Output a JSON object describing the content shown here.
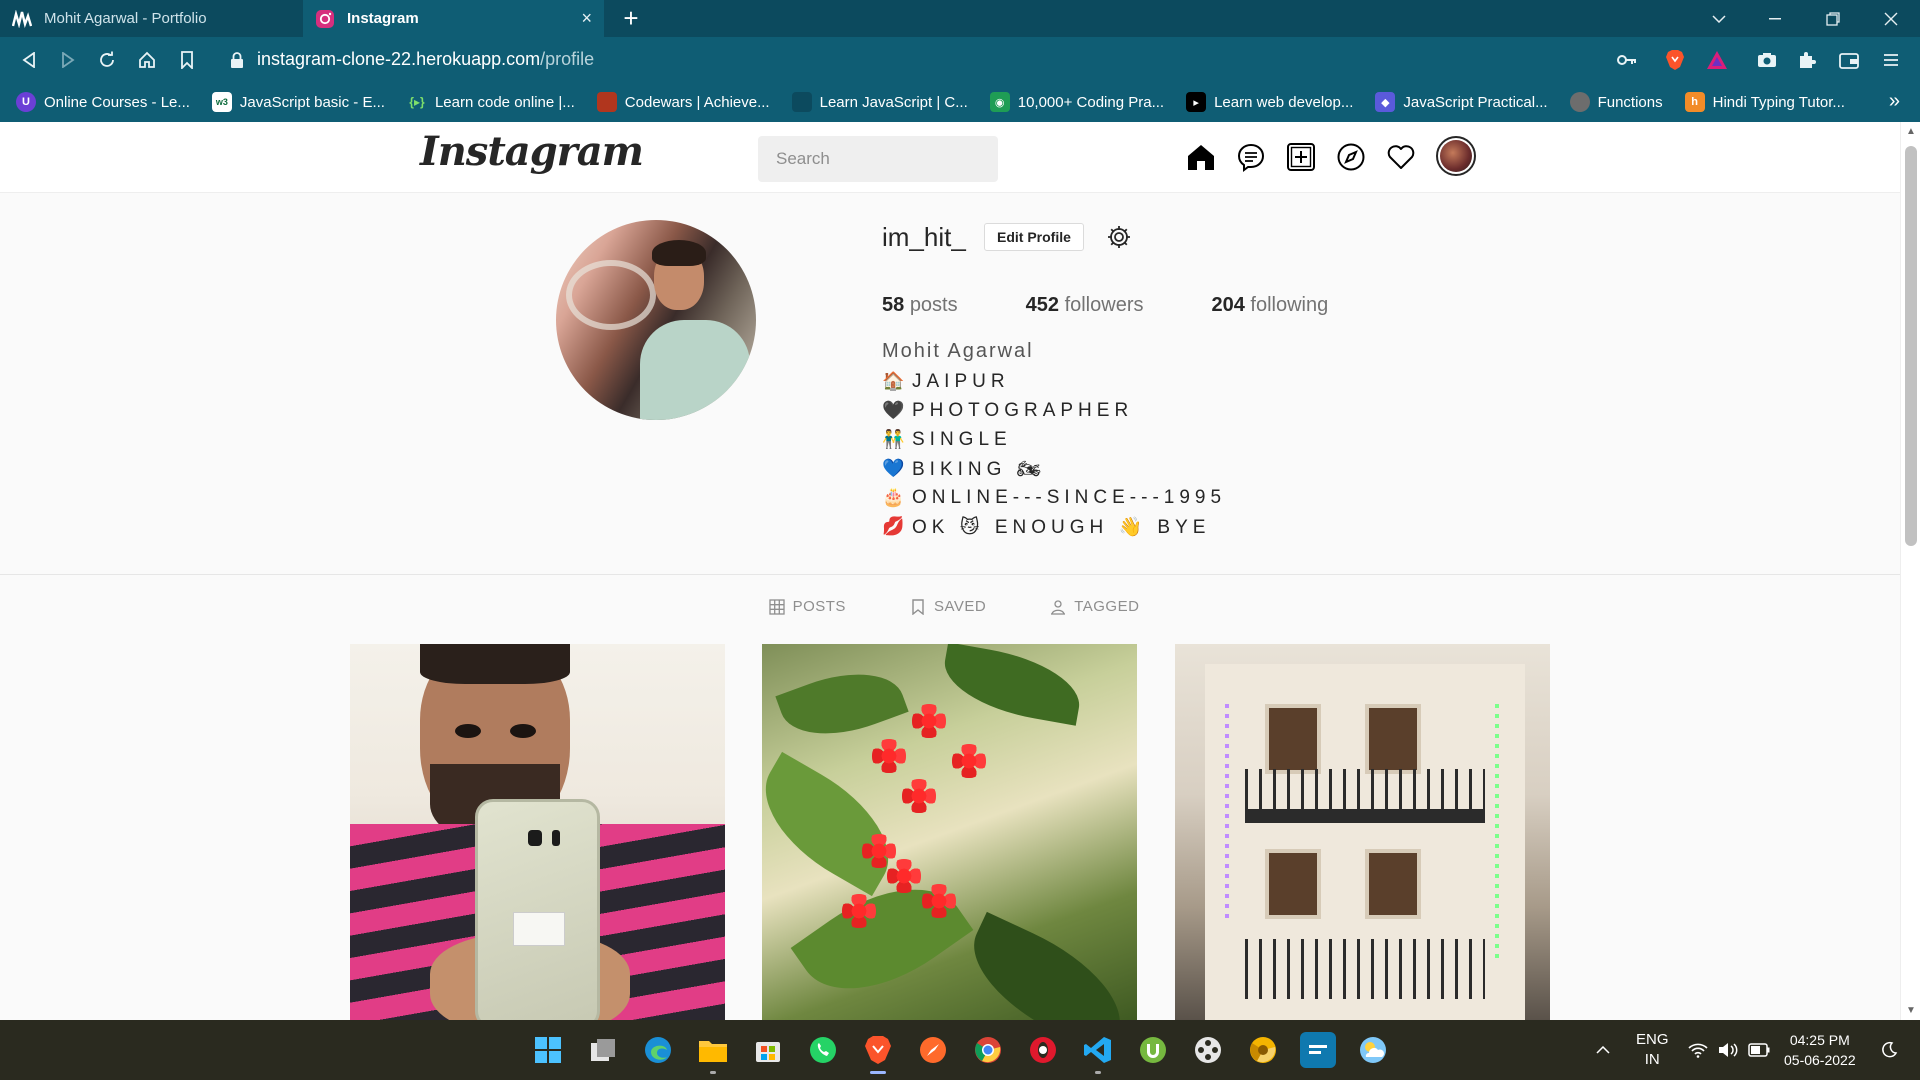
{
  "browser": {
    "tabs": [
      {
        "label": "Mohit Agarwal - Portfolio",
        "active": false,
        "icon": "portfolio-logo-icon"
      },
      {
        "label": "Instagram",
        "active": true,
        "icon": "instagram-icon",
        "close": "×"
      }
    ],
    "new_tab": "+",
    "url_host": "instagram-clone-22.herokuapp.com",
    "url_path": "/profile",
    "bookmarks": [
      {
        "label": "Online Courses - Le...",
        "icon_text": "U",
        "color": "#6b3fd6"
      },
      {
        "label": "JavaScript basic - E...",
        "icon_text": "w3",
        "color": "#ffffff"
      },
      {
        "label": "Learn code online |...",
        "icon_text": "{▸}",
        "color": "#0f5d74"
      },
      {
        "label": "Codewars | Achieve...",
        "icon_text": "",
        "color": "#b1361e"
      },
      {
        "label": "Learn JavaScript | C...",
        "icon_text": "",
        "color": "#0f5d74"
      },
      {
        "label": "10,000+ Coding Pra...",
        "icon_text": "◉",
        "color": "#1f9d55"
      },
      {
        "label": "Learn web develop...",
        "icon_text": "▸",
        "color": "#000000"
      },
      {
        "label": "JavaScript Practical...",
        "icon_text": "◆",
        "color": "#5a5adb"
      },
      {
        "label": "Functions",
        "icon_text": "",
        "color": "#6d6d6d"
      },
      {
        "label": "Hindi Typing Tutor...",
        "icon_text": "h",
        "color": "#f28c28"
      }
    ],
    "bookmarks_more": "»"
  },
  "instagram": {
    "logo": "Instagram",
    "search_placeholder": "Search",
    "profile": {
      "username": "im_hit_",
      "edit_label": "Edit Profile",
      "stats": [
        {
          "value": "58",
          "label": "posts"
        },
        {
          "value": "452",
          "label": "followers"
        },
        {
          "value": "204",
          "label": "following"
        }
      ],
      "full_name": "Mohit Agarwal",
      "bio": [
        {
          "emoji": "🏠",
          "text": "JAIPUR"
        },
        {
          "emoji": "🖤",
          "text": "PHOTOGRAPHER"
        },
        {
          "emoji": "👬",
          "text": "SINGLE"
        },
        {
          "emoji": "💙",
          "text": "BIKING 🏍"
        },
        {
          "emoji": "🎂",
          "text": "ONLINE---SINCE---1995"
        },
        {
          "emoji": "💋",
          "text": "OK 😼 ENOUGH 👋 BYE"
        }
      ]
    },
    "tabs": [
      {
        "label": "POSTS",
        "icon": "grid-icon"
      },
      {
        "label": "SAVED",
        "icon": "bookmark-icon"
      },
      {
        "label": "TAGGED",
        "icon": "tag-person-icon"
      }
    ]
  },
  "taskbar": {
    "language_line1": "ENG",
    "language_line2": "IN",
    "time": "04:25 PM",
    "date": "05-06-2022",
    "show_hidden": "^"
  },
  "colors": {
    "browser_tab_bar": "#0c4a5e",
    "browser_toolbar": "#0f5d74",
    "page_bg": "#fafafa",
    "taskbar": "#2a2a1f"
  }
}
